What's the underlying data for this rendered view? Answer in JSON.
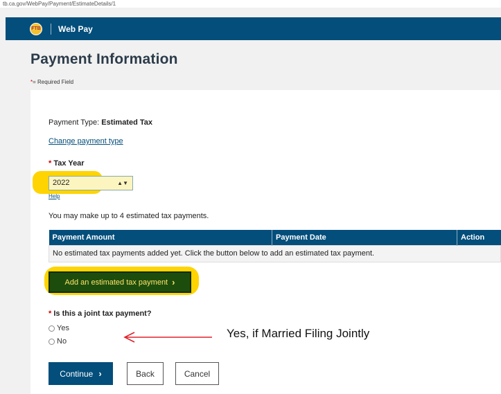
{
  "browser": {
    "url": "tb.ca.gov/WebPay/Payment/EstimateDetails/1"
  },
  "header": {
    "logo_text": "FTB",
    "title": "Web Pay"
  },
  "page": {
    "title": "Payment Information",
    "required_star": "*",
    "required_note": "= Required Field"
  },
  "form": {
    "payment_type_label": "Payment Type:",
    "payment_type_value": "Estimated Tax",
    "change_link": "Change payment type",
    "tax_year": {
      "star": "*",
      "label": "Tax Year",
      "selected": "2022",
      "help": "Help"
    },
    "info": "You may make up to 4 estimated tax payments.",
    "table": {
      "headers": [
        "Payment Amount",
        "Payment Date",
        "Action"
      ],
      "empty_message": "No estimated tax payments added yet. Click the button below to add an estimated tax payment."
    },
    "add_button": "Add an estimated tax payment",
    "joint": {
      "star": "*",
      "label": "Is this a joint tax payment?",
      "options": [
        "Yes",
        "No"
      ]
    },
    "buttons": {
      "continue": "Continue",
      "back": "Back",
      "cancel": "Cancel"
    }
  },
  "annotation": {
    "text": "Yes, if Married Filing Jointly",
    "arrow_color": "#e0202a",
    "highlight_color": "#ffd400"
  }
}
